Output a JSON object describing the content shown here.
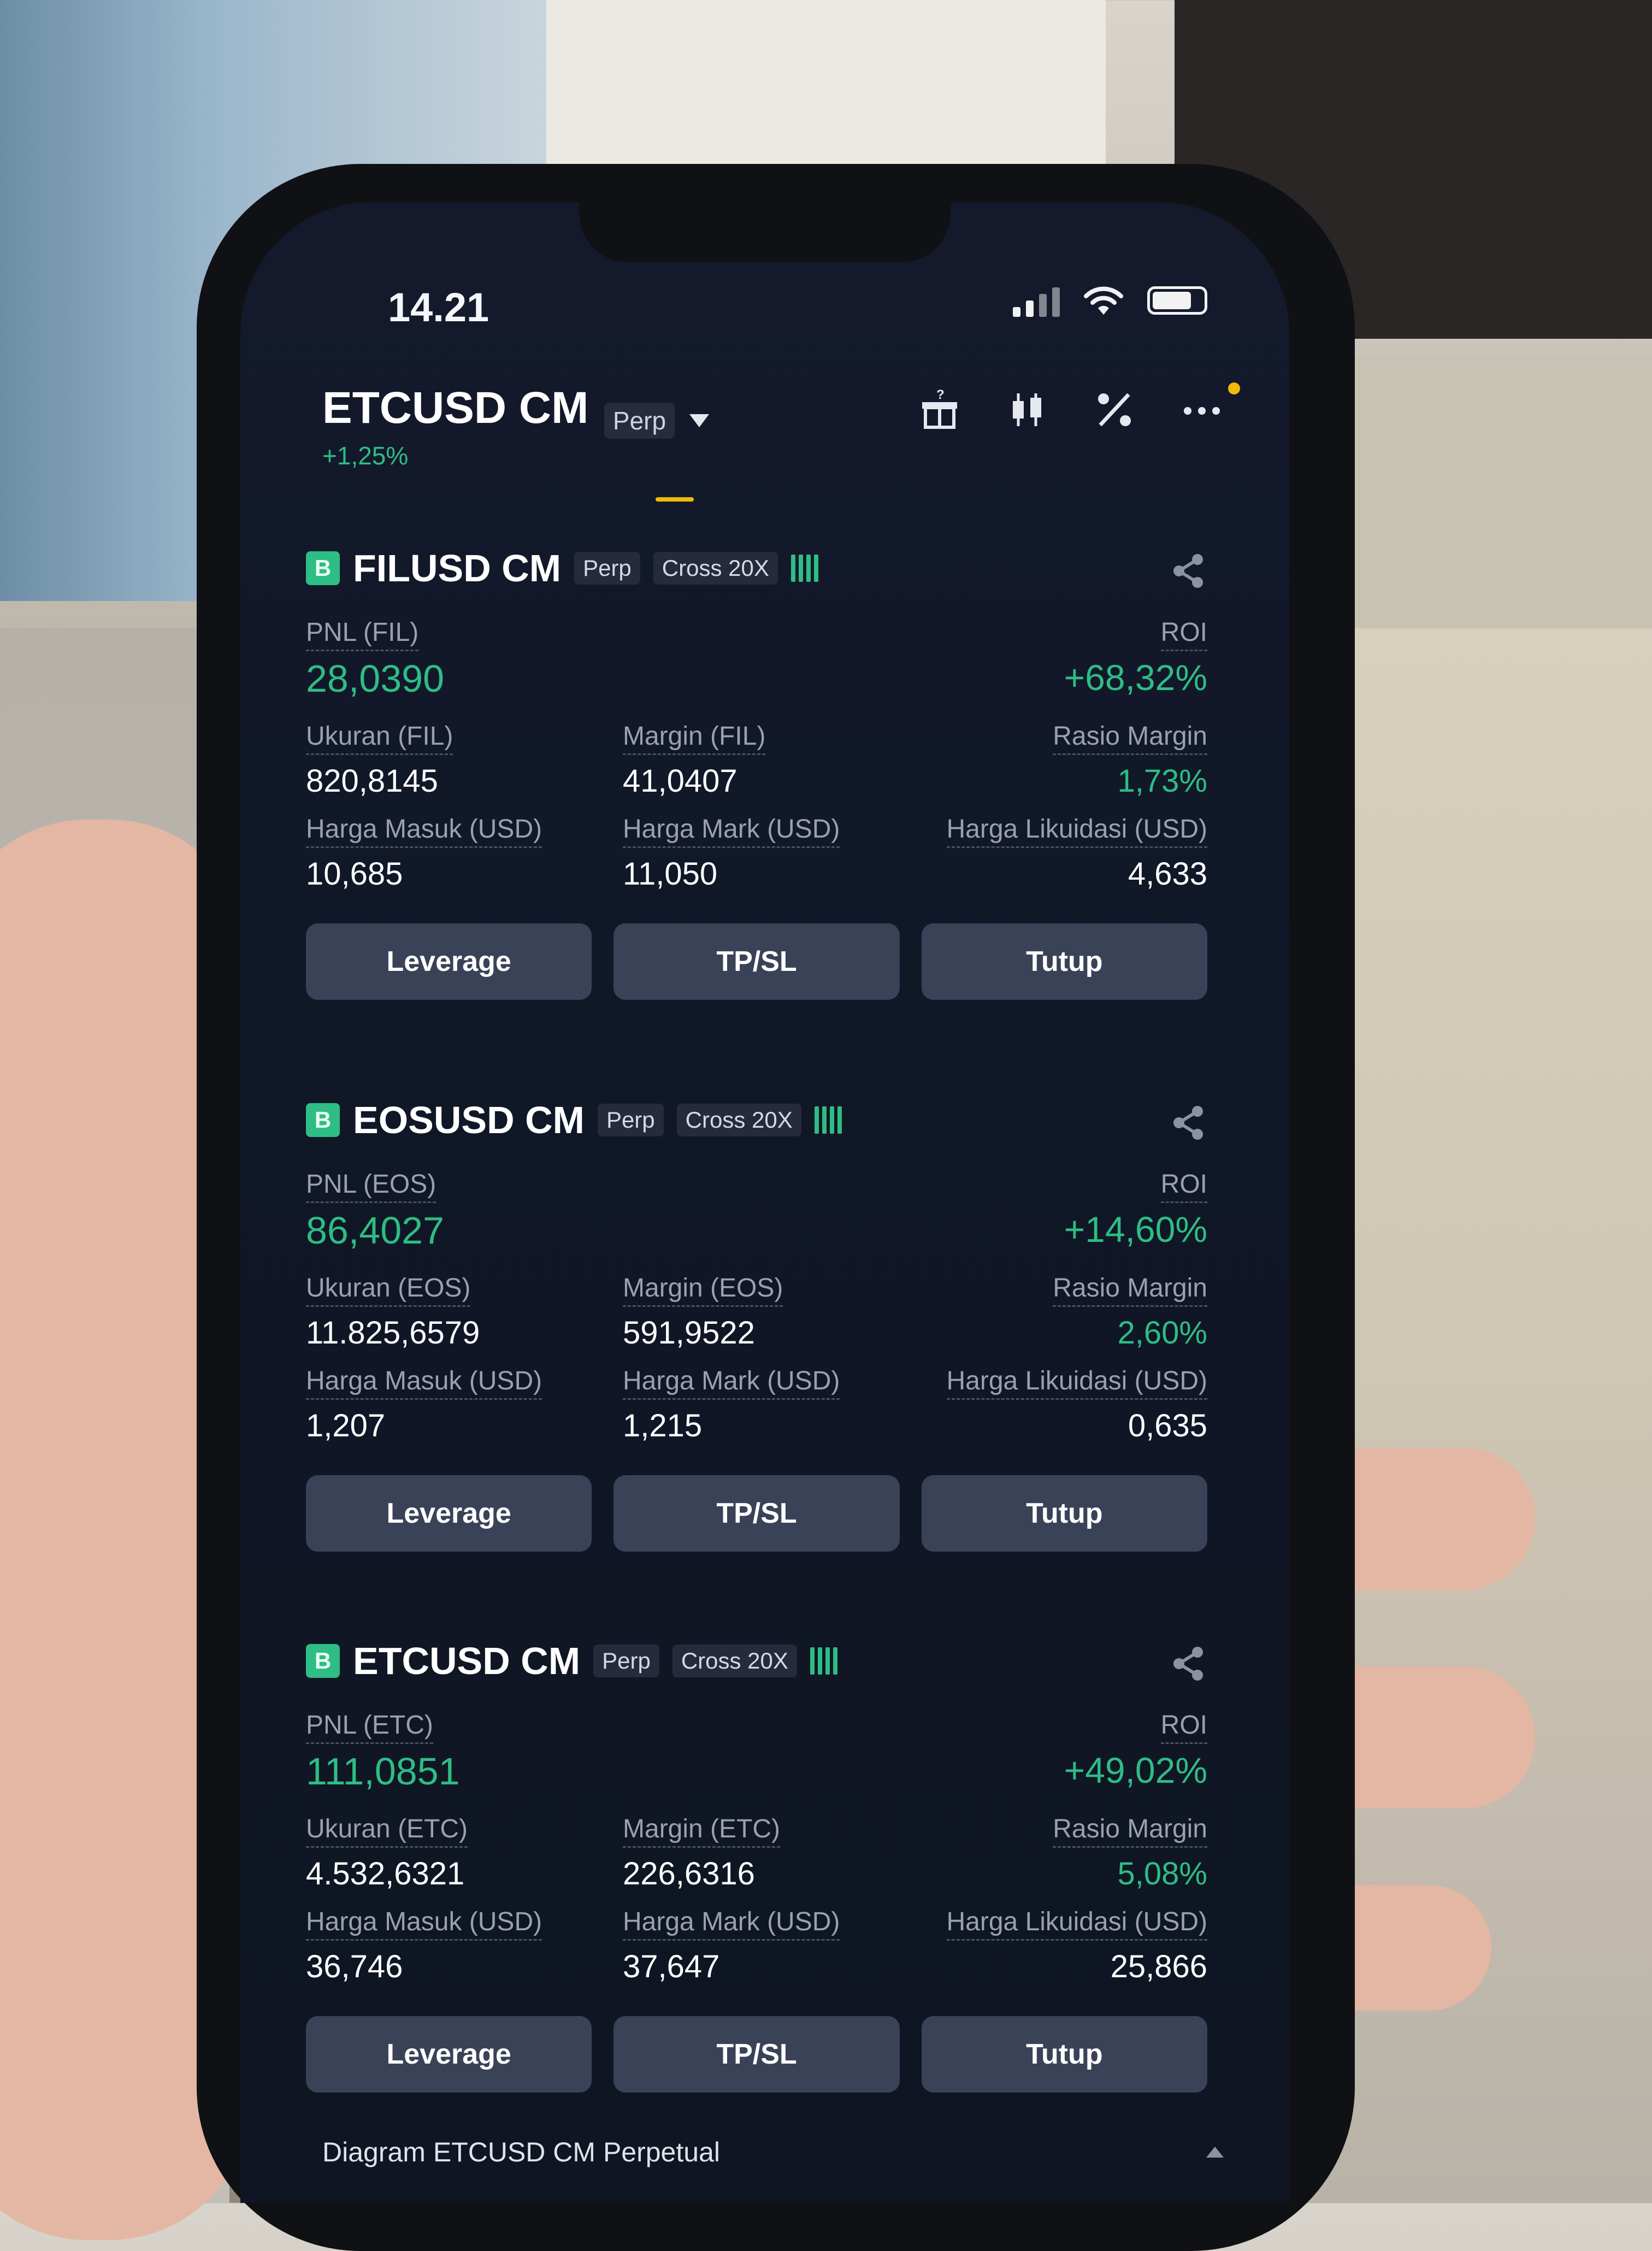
{
  "status": {
    "time": "14.21"
  },
  "header": {
    "symbol": "ETCUSD CM",
    "type": "Perp",
    "change": "+1,25%",
    "icons": [
      "gift-icon",
      "candlestick-icon",
      "percent-icon",
      "more-icon"
    ]
  },
  "positions": [
    {
      "symbol": "FILUSD CM",
      "badge": "B",
      "type": "Perp",
      "mode": "Cross 20X",
      "pnl_label": "PNL (FIL)",
      "pnl": "28,0390",
      "roi_label": "ROI",
      "roi": "+68,32%",
      "size_label": "Ukuran (FIL)",
      "size": "820,8145",
      "margin_label": "Margin (FIL)",
      "margin": "41,0407",
      "ratio_label": "Rasio Margin",
      "ratio": "1,73%",
      "entry_label": "Harga Masuk (USD)",
      "entry": "10,685",
      "mark_label": "Harga Mark (USD)",
      "mark": "11,050",
      "liq_label": "Harga Likuidasi (USD)",
      "liq": "4,633"
    },
    {
      "symbol": "EOSUSD CM",
      "badge": "B",
      "type": "Perp",
      "mode": "Cross 20X",
      "pnl_label": "PNL (EOS)",
      "pnl": "86,4027",
      "roi_label": "ROI",
      "roi": "+14,60%",
      "size_label": "Ukuran (EOS)",
      "size": "11.825,6579",
      "margin_label": "Margin (EOS)",
      "margin": "591,9522",
      "ratio_label": "Rasio Margin",
      "ratio": "2,60%",
      "entry_label": "Harga Masuk (USD)",
      "entry": "1,207",
      "mark_label": "Harga Mark (USD)",
      "mark": "1,215",
      "liq_label": "Harga Likuidasi (USD)",
      "liq": "0,635"
    },
    {
      "symbol": "ETCUSD CM",
      "badge": "B",
      "type": "Perp",
      "mode": "Cross 20X",
      "pnl_label": "PNL (ETC)",
      "pnl": "111,0851",
      "roi_label": "ROI",
      "roi": "+49,02%",
      "size_label": "Ukuran (ETC)",
      "size": "4.532,6321",
      "margin_label": "Margin (ETC)",
      "margin": "226,6316",
      "ratio_label": "Rasio Margin",
      "ratio": "5,08%",
      "entry_label": "Harga Masuk (USD)",
      "entry": "36,746",
      "mark_label": "Harga Mark (USD)",
      "mark": "37,647",
      "liq_label": "Harga Likuidasi (USD)",
      "liq": "25,866"
    }
  ],
  "buttons": {
    "leverage": "Leverage",
    "tpsl": "TP/SL",
    "close": "Tutup"
  },
  "footer": {
    "chart_label": "Diagram ETCUSD CM Perpetual"
  },
  "colors": {
    "profit": "#2ebd85",
    "accent": "#f0b90b",
    "background": "#121828",
    "button": "#3a4257"
  }
}
